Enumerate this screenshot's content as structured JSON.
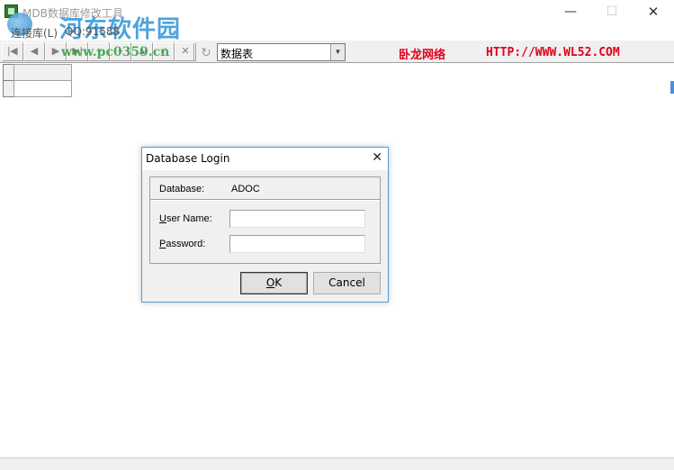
{
  "window": {
    "title": "MDB数据库修改工具",
    "minimize_glyph": "—",
    "maximize_glyph": "☐",
    "close_glyph": "✕"
  },
  "watermark": {
    "site_name": "河东软件园",
    "site_url": "www.pc0359.cn"
  },
  "menu": {
    "items": [
      "连接库(L)",
      "QQ:91588"
    ]
  },
  "toolbar": {
    "table_select_value": "数据表",
    "brand_name": "卧龙网络",
    "brand_url": "HTTP://WWW.WL52.COM"
  },
  "dialog": {
    "title": "Database Login",
    "close_glyph": "✕",
    "database_label": "Database:",
    "database_value": "ADOC",
    "username_label_prefix": "U",
    "username_label_rest": "ser Name:",
    "username_value": "",
    "password_label_prefix": "P",
    "password_label_rest": "assword:",
    "password_value": "",
    "ok_label_prefix": "O",
    "ok_label_rest": "K",
    "cancel_label": "Cancel"
  },
  "icons": {
    "app": "database-app-icon",
    "refresh": "refresh-icon",
    "dropdown": "chevron-down-icon"
  },
  "colors": {
    "brand_red": "#e0001a",
    "dialog_border": "#5b9bd5"
  }
}
